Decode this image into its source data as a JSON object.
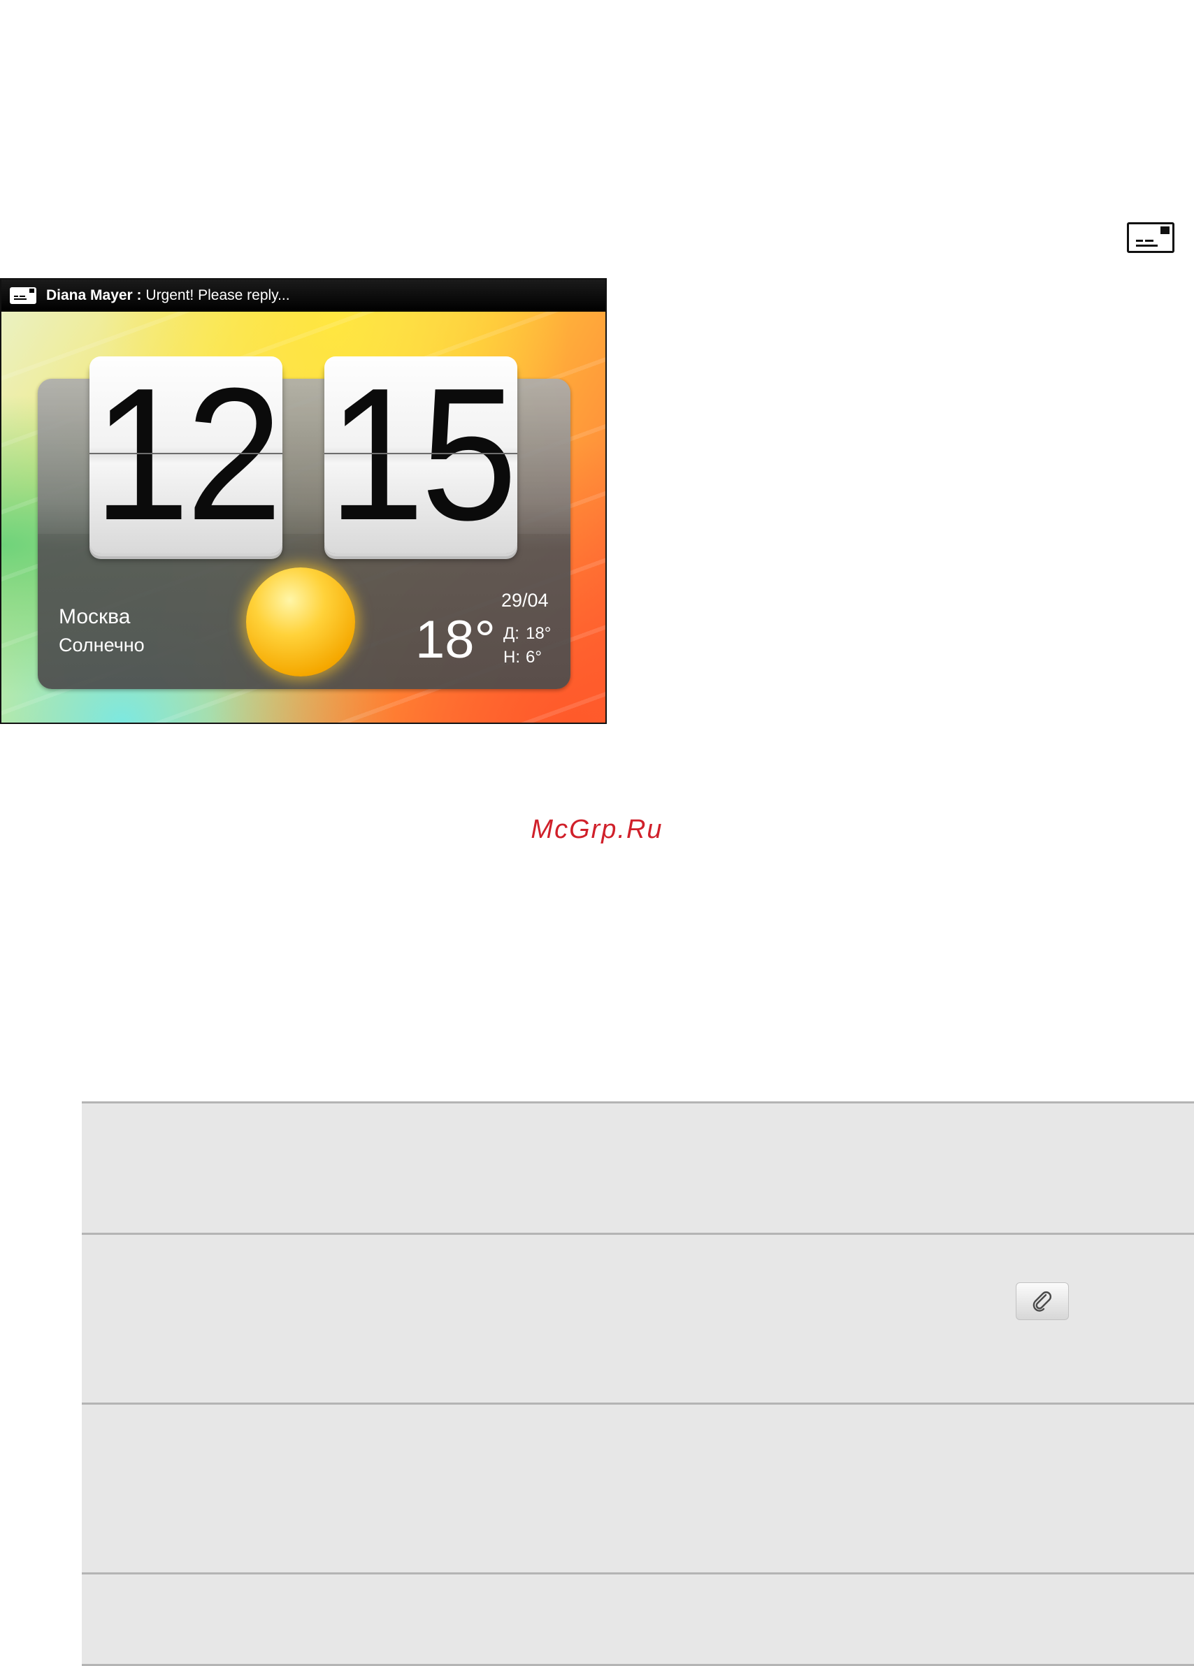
{
  "top_icon": "envelope-new-mail-icon",
  "status_bar": {
    "icon": "envelope-new-mail-icon",
    "sender": "Diana Mayer :",
    "message": " Urgent! Please reply..."
  },
  "clock": {
    "hours": "12",
    "minutes": "15"
  },
  "weather": {
    "city": "Москва",
    "condition": "Солнечно",
    "date": "29/04",
    "temperature": "18°",
    "high_label": "Д:",
    "high_value": "18°",
    "low_label": "Н:",
    "low_value": "6°",
    "icon": "sun-icon"
  },
  "watermark": "McGrp.Ru",
  "table": {
    "attachment_icon": "paperclip-icon"
  }
}
